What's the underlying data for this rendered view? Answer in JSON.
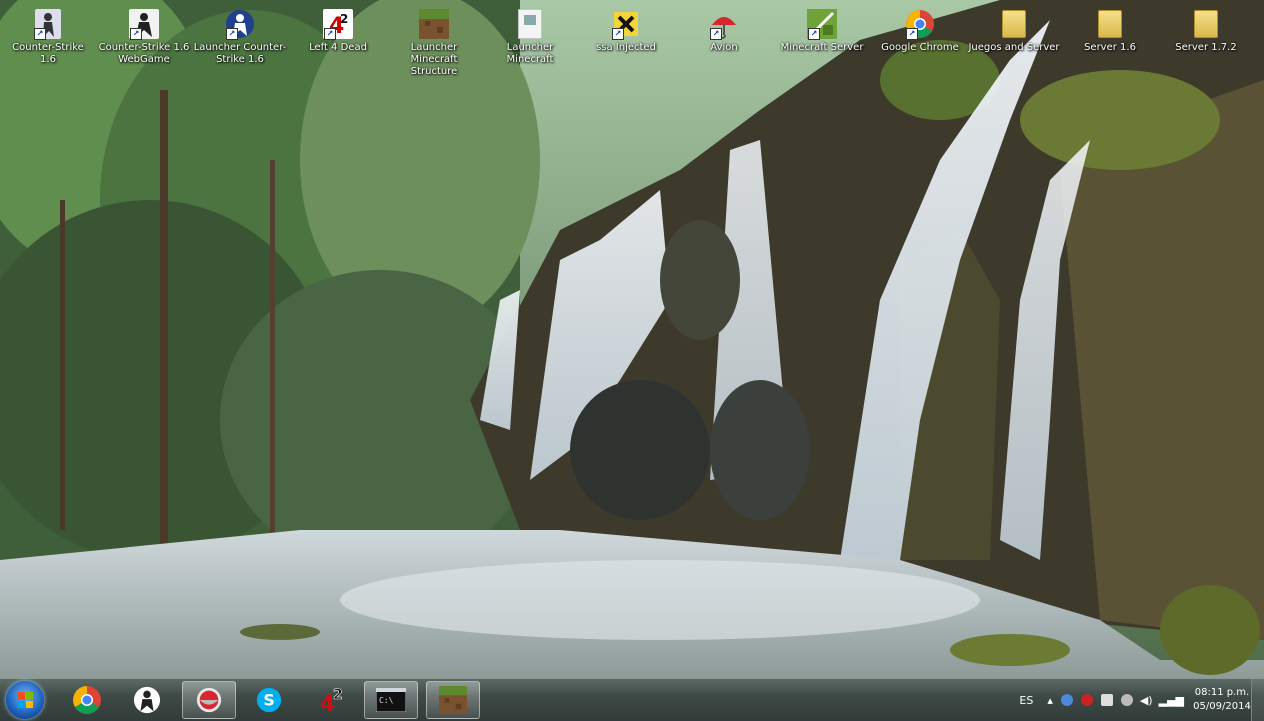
{
  "desktop": {
    "icons": [
      {
        "label": "Counter-Strike\n1.6",
        "icon": "counter-strike-icon"
      },
      {
        "label": "Counter-Strike 1.6\nWebGame",
        "icon": "counter-strike-icon"
      },
      {
        "label": "Launcher Counter-\nStrike 1.6",
        "icon": "counter-strike-icon"
      },
      {
        "label": "Left 4 Dead",
        "icon": "left-4-dead-icon"
      },
      {
        "label": "Launcher Minecraft\nStructure",
        "icon": "minecraft-icon"
      },
      {
        "label": "Launcher\nMinecraft",
        "icon": "launcher-icon"
      },
      {
        "label": "ssa Injected",
        "icon": "injector-icon"
      },
      {
        "label": "Avion",
        "icon": "umbrella-icon"
      },
      {
        "label": "Minecraft Server",
        "icon": "minecraft-server-icon"
      },
      {
        "label": "Google Chrome",
        "icon": "chrome-icon"
      },
      {
        "label": "Juegos and Server",
        "icon": "folder-icon"
      },
      {
        "label": "Server 1.6",
        "icon": "folder-icon"
      },
      {
        "label": "Server 1.7.2",
        "icon": "folder-icon"
      }
    ]
  },
  "taskbar": {
    "start_label": "Start",
    "buttons": [
      {
        "icon": "chrome-icon",
        "active": false
      },
      {
        "icon": "counter-strike-icon",
        "active": false
      },
      {
        "icon": "recording-icon",
        "active": true
      },
      {
        "icon": "skype-icon",
        "active": false
      },
      {
        "icon": "left-4-dead-2-icon",
        "active": false
      },
      {
        "icon": "command-prompt-icon",
        "active": true
      },
      {
        "icon": "minecraft-icon",
        "active": true
      }
    ],
    "tray": {
      "language": "ES",
      "time": "08:11 p.m.",
      "date": "05/09/2014"
    }
  },
  "colors": {
    "chrome_red": "#db4437",
    "chrome_green": "#0f9d58",
    "chrome_yellow": "#f4b400",
    "chrome_blue": "#4285f4",
    "skype_blue": "#00aff0",
    "minecraft_green": "#5d8a2f",
    "taskbar_bg": "#3e4a47"
  }
}
